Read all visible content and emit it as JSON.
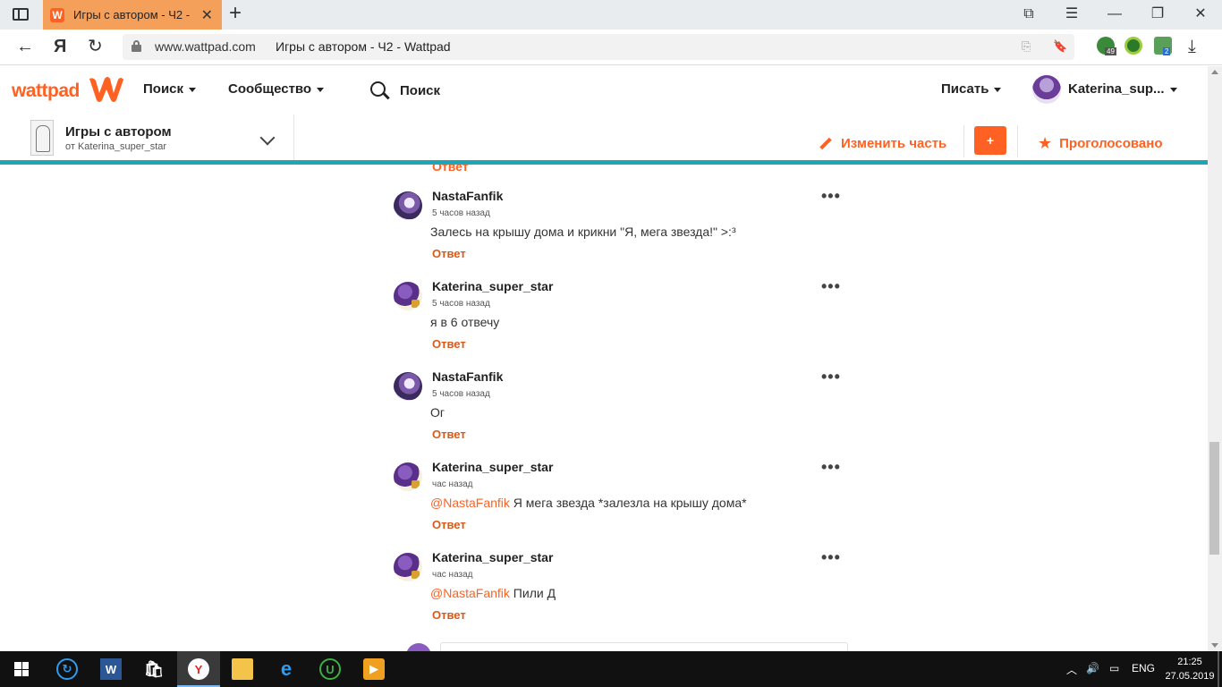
{
  "browser": {
    "tab_title": "Игры с автором - Ч2 -",
    "favicon_letter": "W",
    "url_domain": "www.wattpad.com",
    "url_title": "Игры с автором - Ч2 - Wattpad",
    "ext_badge_1": "49",
    "ext_badge_2": "2"
  },
  "header": {
    "logo": "wattpad",
    "nav_search": "Поиск",
    "nav_community": "Сообщество",
    "search_label": "Поиск",
    "write": "Писать",
    "username": "Katerina_sup..."
  },
  "story": {
    "title": "Игры с автором",
    "author": "от Katerina_super_star",
    "edit_part": "Изменить часть",
    "add": "+",
    "voted": "Проголосовано"
  },
  "comments": {
    "partial_reply": "Ответ",
    "items": [
      {
        "user": "NastaFanfik",
        "time": "5 часов назад",
        "mention": "",
        "text": "Залесь на крышу дома и крикни \"Я, мега звезда!\" >:³",
        "reply": "Ответ",
        "avatar": "nasta"
      },
      {
        "user": "Katerina_super_star",
        "time": "5 часов назад",
        "mention": "",
        "text": "я в 6 отвечу",
        "reply": "Ответ",
        "avatar": "kat"
      },
      {
        "user": "NastaFanfik",
        "time": "5 часов назад",
        "mention": "",
        "text": "Ог",
        "reply": "Ответ",
        "avatar": "nasta"
      },
      {
        "user": "Katerina_super_star",
        "time": "час назад",
        "mention": "@NastaFanfik",
        "text": " Я мега звезда *залезла на крышу дома*",
        "reply": "Ответ",
        "avatar": "kat"
      },
      {
        "user": "Katerina_super_star",
        "time": "час назад",
        "mention": "@NastaFanfik",
        "text": " Пили Д",
        "reply": "Ответ",
        "avatar": "kat"
      }
    ]
  },
  "taskbar": {
    "lang": "ENG",
    "time": "21:25",
    "date": "27.05.2019"
  },
  "colors": {
    "brand": "#ff6122",
    "teal": "#1fa6b4",
    "tab_active": "#f5a05a"
  }
}
